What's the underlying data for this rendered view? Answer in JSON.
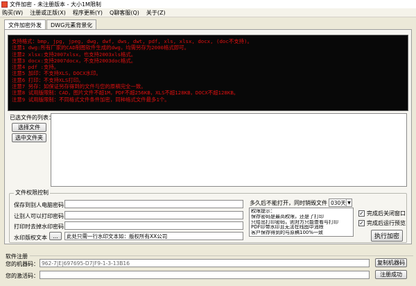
{
  "window": {
    "title": "文件加密 - 未注册版本 - 大小1M限制"
  },
  "menu": [
    "购买(W)",
    "注册或正版(X)",
    "程序更新(Y)",
    "Q聊客服(Q)",
    "关于(Z)"
  ],
  "tabs": [
    "文件加密外发",
    "DWG元素背景化"
  ],
  "console_lines": [
    "支持格式：bmp, jpg, jpeg, dwg, dwf, dws, dwt, pdf, xls, xlsx, docx, (doc不支持)。",
    "注意1 dwg:所有厂家的CAD制图软件生成的dwg，均需另存为2000格式即可。",
    "注意2 xlsx:支持2007xlsx，也支持2003xls格式。",
    "注意3 docx:支持2007docx，不支持2003doc格式。",
    "注意4 pdf :支持。",
    "注意5 加印：不支持XLS，DOCX水印。",
    "注意6 打印：不支持XLS打印。",
    "注意7 另存：如保证另存得到的文件与您的原稿完全一致。",
    "注意8 试用版限制：CAD，图片文件不超1M，PDF不超256KB，XLS不超128KB，DOCX不超128KB。",
    "注意9 试用版限制：不同格式文件条件加密，同种格式文件最多1个。"
  ],
  "files": {
    "label": "已选文件的列表：",
    "select_file": "选择文件",
    "select_folder": "选中文件夹"
  },
  "permissions": {
    "title": "文件权限控制",
    "save_password_label": "保存到别人电脑密码",
    "print_password_label": "让别人可以打印密码",
    "watermark_password_label": "打印时去掉水印密码",
    "watermark_text_label": "水印版权文本",
    "watermark_browse": "...",
    "watermark_text_value": "此处只需一行水印文本如：版权所有XX公司",
    "expire_label": "多久后不能打开，同时销毁文件",
    "expire_value": "030天",
    "tips": [
      "权限提示：",
      "保存密码是最高权限，还是了打印",
      "只给出打印密码，则对方只能查看与打印",
      "PDF印带水印且无法在线图中消除",
      "客户保存得到的与原稿100%一致"
    ],
    "close_after": "完成后关闭窗口",
    "run_preview": "完成后运行预览",
    "execute": "执行加密"
  },
  "registration": {
    "title": "软件注册",
    "machine_code_label": "您的机器码：",
    "machine_code_value": "962-7|E|697695-D7|F9-1-3-13B16",
    "copy_button": "复制机器码",
    "activation_label": "您的激活码：",
    "activation_value": "",
    "register_button": "注册成功"
  }
}
